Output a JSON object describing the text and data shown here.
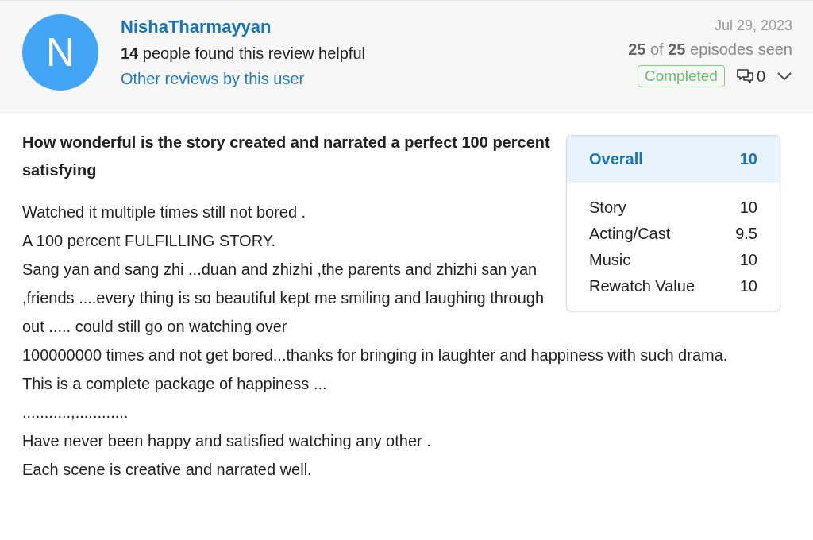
{
  "reviewer": {
    "initial": "N",
    "name": "NishaTharmayyan",
    "helpful": "**14** people found this review helpful",
    "other_reviews_link": "Other reviews by this user"
  },
  "meta": {
    "date": "Jul 29, 2023",
    "episodes": "**25** of **25** episodes seen",
    "status": "Completed",
    "comment_count": "0"
  },
  "review": {
    "title": "How wonderful is the story created and narrated a perfect 100 percent satisfying",
    "lines": [
      "Watched it multiple times still not bored .",
      "A 100 percent FULFILLING STORY.",
      "Sang yan and sang zhi ...duan and zhizhi ,the parents and zhizhi san yan ,friends ....every thing is so beautiful kept me smiling and laughing through out ..... could still go on watching over",
      "100000000 times and not get bored...thanks for bringing in laughter and happiness with such drama.",
      "This is a complete package of happiness ...",
      "...........,............",
      "Have never been happy and satisfied watching any other .",
      "Each scene is creative and narrated well."
    ]
  },
  "scores": {
    "overall": {
      "label": "Overall",
      "value": "10"
    },
    "items": [
      {
        "label": "Story",
        "value": "10"
      },
      {
        "label": "Acting/Cast",
        "value": "9.5"
      },
      {
        "label": "Music",
        "value": "10"
      },
      {
        "label": "Rewatch Value",
        "value": "10"
      }
    ]
  }
}
